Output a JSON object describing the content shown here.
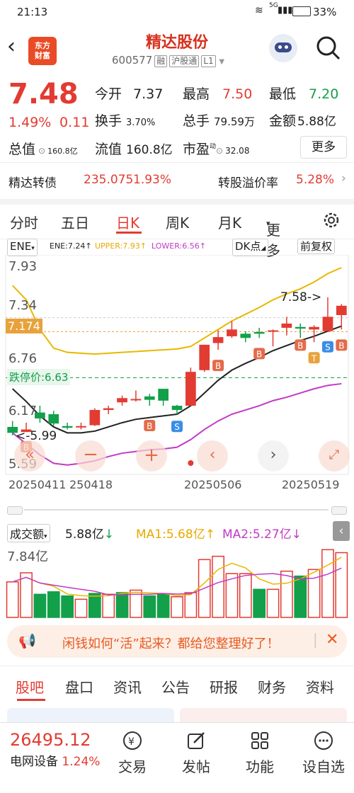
{
  "status": {
    "time": "21:13",
    "signal": "5G",
    "battery": "33%"
  },
  "header": {
    "logo_line1": "东方",
    "logo_line2": "财富",
    "title": "精达股份",
    "code": "600577",
    "tags": [
      "融",
      "沪股通",
      "L1"
    ]
  },
  "quote": {
    "price": "7.48",
    "change_pct": "1.49%",
    "change": "0.11",
    "open_label": "今开",
    "open": "7.37",
    "high_label": "最高",
    "high": "7.50",
    "low_label": "最低",
    "low": "7.20",
    "turnover_label": "换手",
    "turnover": "3.70%",
    "volume_label": "总手",
    "volume": "79.59万",
    "amount_label": "金额",
    "amount": "5.88亿",
    "total_value_label": "总值",
    "total_value": "160.8亿",
    "float_value_label": "流值",
    "float_value": "160.8亿",
    "pe_label": "市盈",
    "pe_sup": "动",
    "pe": "32.08",
    "more": "更多"
  },
  "bond": {
    "name": "精达转债",
    "price": "235.075",
    "pct": "1.93%",
    "premium_label": "转股溢价率",
    "premium": "5.28%"
  },
  "tabs": [
    "分时",
    "五日",
    "日K",
    "周K",
    "月K",
    "更多"
  ],
  "active_tab": "日K",
  "chart_top": {
    "indicator": "ENE",
    "ene": "ENE:7.24↑",
    "upper": "UPPER:7.93↑",
    "lower": "LOWER:6.56↑",
    "dk": "DK点",
    "fq": "前复权"
  },
  "kline": {
    "y_labels": [
      "7.93",
      "7.34",
      "6.76",
      "6.17",
      "5.59"
    ],
    "current": "7.174",
    "limit_down": "跌停价:6.63",
    "high_note": "7.58",
    "low_note": "5.99",
    "dates": [
      "20250411",
      "250418",
      "20250506",
      "20250519"
    ],
    "signals": [
      "B",
      "B",
      "S",
      "B",
      "B",
      "B",
      "T",
      "S",
      "B"
    ]
  },
  "chart_data": {
    "type": "candlestick",
    "ylim": [
      5.59,
      7.93
    ],
    "candles": [
      {
        "o": 6.05,
        "c": 5.98,
        "h": 6.12,
        "l": 5.95
      },
      {
        "o": 5.99,
        "c": 6.02,
        "h": 6.1,
        "l": 5.99
      },
      {
        "o": 6.22,
        "c": 6.15,
        "h": 6.3,
        "l": 6.1
      },
      {
        "o": 6.2,
        "c": 6.09,
        "h": 6.24,
        "l": 6.06
      },
      {
        "o": 6.06,
        "c": 6.04,
        "h": 6.1,
        "l": 6.02
      },
      {
        "o": 6.05,
        "c": 6.06,
        "h": 6.1,
        "l": 6.02
      },
      {
        "o": 6.07,
        "c": 6.25,
        "h": 6.27,
        "l": 6.06
      },
      {
        "o": 6.25,
        "c": 6.27,
        "h": 6.3,
        "l": 6.2
      },
      {
        "o": 6.34,
        "c": 6.39,
        "h": 6.42,
        "l": 6.3
      },
      {
        "o": 6.37,
        "c": 6.38,
        "h": 6.48,
        "l": 6.35
      },
      {
        "o": 6.41,
        "c": 6.37,
        "h": 6.44,
        "l": 6.3
      },
      {
        "o": 6.5,
        "c": 6.36,
        "h": 6.5,
        "l": 6.3
      },
      {
        "o": 6.3,
        "c": 6.25,
        "h": 6.31,
        "l": 6.2
      },
      {
        "o": 6.3,
        "c": 6.7,
        "h": 6.75,
        "l": 6.3
      },
      {
        "o": 6.72,
        "c": 7.02,
        "h": 7.02,
        "l": 6.7
      },
      {
        "o": 7.04,
        "c": 7.11,
        "h": 7.19,
        "l": 6.96
      },
      {
        "o": 7.12,
        "c": 7.2,
        "h": 7.3,
        "l": 7.1
      },
      {
        "o": 7.15,
        "c": 7.1,
        "h": 7.18,
        "l": 7.05
      },
      {
        "o": 7.17,
        "c": 7.15,
        "h": 7.22,
        "l": 7.1
      },
      {
        "o": 7.19,
        "c": 7.19,
        "h": 7.2,
        "l": 7.0
      },
      {
        "o": 7.22,
        "c": 7.27,
        "h": 7.35,
        "l": 7.13
      },
      {
        "o": 7.23,
        "c": 7.21,
        "h": 7.27,
        "l": 7.1
      },
      {
        "o": 7.2,
        "c": 7.23,
        "h": 7.25,
        "l": 7.05
      },
      {
        "o": 7.18,
        "c": 7.35,
        "h": 7.58,
        "l": 7.18
      },
      {
        "o": 7.37,
        "c": 7.48,
        "h": 7.5,
        "l": 7.2
      }
    ],
    "upper": [
      7.72,
      7.55,
      7.2,
      6.98,
      6.93,
      6.92,
      6.91,
      6.92,
      6.93,
      6.94,
      6.95,
      6.96,
      6.97,
      7.0,
      7.1,
      7.2,
      7.3,
      7.38,
      7.46,
      7.55,
      7.62,
      7.68,
      7.76,
      7.86,
      7.93
    ],
    "ene": [
      6.5,
      6.35,
      6.18,
      6.05,
      5.98,
      5.98,
      6.0,
      6.05,
      6.1,
      6.14,
      6.16,
      6.18,
      6.2,
      6.3,
      6.45,
      6.6,
      6.72,
      6.8,
      6.87,
      6.95,
      7.01,
      7.07,
      7.12,
      7.18,
      7.24
    ],
    "lower": [
      5.98,
      5.85,
      5.72,
      5.62,
      5.6,
      5.62,
      5.65,
      5.7,
      5.74,
      5.76,
      5.78,
      5.79,
      5.81,
      5.9,
      6.02,
      6.12,
      6.2,
      6.25,
      6.3,
      6.36,
      6.4,
      6.45,
      6.5,
      6.54,
      6.56
    ],
    "volume": {
      "label": "成交额",
      "value": "5.88亿",
      "ma1": "MA1:5.68亿",
      "ma2": "MA2:5.27亿",
      "max": "7.84亿",
      "bars": [
        4.3,
        5.4,
        2.8,
        3.1,
        2.6,
        2.2,
        2.9,
        2.8,
        3.0,
        3.3,
        2.6,
        2.8,
        2.5,
        3.0,
        7.0,
        7.4,
        5.3,
        5.3,
        3.4,
        3.4,
        5.6,
        5.0,
        5.8,
        8.2,
        7.84
      ],
      "up": [
        true,
        true,
        false,
        false,
        false,
        true,
        false,
        true,
        false,
        true,
        false,
        false,
        true,
        true,
        true,
        true,
        true,
        true,
        false,
        true,
        true,
        false,
        true,
        true,
        true
      ]
    }
  },
  "banner": {
    "text": "闲钱如何“活”起来？都给您整理好了！"
  },
  "bottom_tabs": [
    "股吧",
    "盘口",
    "资讯",
    "公告",
    "研报",
    "财务",
    "资料"
  ],
  "nav": {
    "index_value": "26495.12",
    "index_name": "电网设备",
    "index_pct": "1.24%",
    "items": [
      "交易",
      "发帖",
      "功能",
      "设自选"
    ]
  }
}
